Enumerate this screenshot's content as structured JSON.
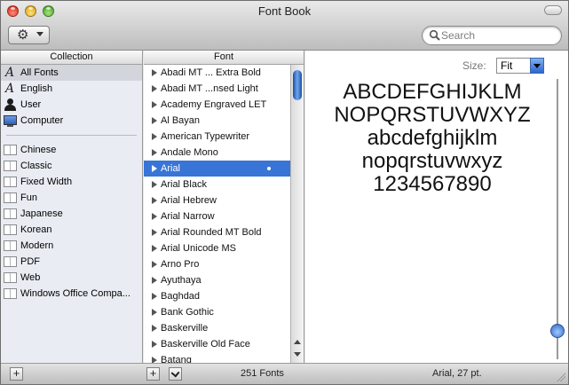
{
  "window": {
    "title": "Font Book"
  },
  "toolbar": {
    "action_icon": "gear-icon",
    "search": {
      "placeholder": "Search",
      "value": ""
    }
  },
  "collection": {
    "header": "Collection",
    "top_items": [
      {
        "label": "All Fonts",
        "icon": "font-a-icon",
        "selected": true
      },
      {
        "label": "English",
        "icon": "font-a-icon"
      },
      {
        "label": "User",
        "icon": "user-icon"
      },
      {
        "label": "Computer",
        "icon": "computer-icon"
      }
    ],
    "items": [
      {
        "label": "Chinese",
        "icon": "book-icon"
      },
      {
        "label": "Classic",
        "icon": "book-icon"
      },
      {
        "label": "Fixed Width",
        "icon": "book-icon"
      },
      {
        "label": "Fun",
        "icon": "book-icon"
      },
      {
        "label": "Japanese",
        "icon": "book-icon"
      },
      {
        "label": "Korean",
        "icon": "book-icon"
      },
      {
        "label": "Modern",
        "icon": "book-icon"
      },
      {
        "label": "PDF",
        "icon": "book-icon"
      },
      {
        "label": "Web",
        "icon": "book-icon"
      },
      {
        "label": "Windows Office Compa...",
        "icon": "book-icon"
      }
    ]
  },
  "fonts": {
    "header": "Font",
    "items": [
      "Abadi MT ... Extra Bold",
      "Abadi MT ...nsed Light",
      "Academy Engraved LET",
      "Al Bayan",
      "American Typewriter",
      "Andale Mono",
      "Arial",
      "Arial Black",
      "Arial Hebrew",
      "Arial Narrow",
      "Arial Rounded MT Bold",
      "Arial Unicode MS",
      "Arno Pro",
      "Ayuthaya",
      "Baghdad",
      "Bank Gothic",
      "Baskerville",
      "Baskerville Old Face",
      "Batang"
    ],
    "selected": "Arial"
  },
  "preview": {
    "size_label": "Size:",
    "size_value": "Fit",
    "lines": [
      "ABCDEFGHIJKLM",
      "NOPQRSTUVWXYZ",
      "abcdefghijklm",
      "nopqrstuvwxyz",
      "1234567890"
    ]
  },
  "status": {
    "font_count": "251 Fonts",
    "selection": "Arial, 27 pt."
  },
  "colors": {
    "selection": "#3875d7",
    "collection_bg": "#e9edf3"
  }
}
